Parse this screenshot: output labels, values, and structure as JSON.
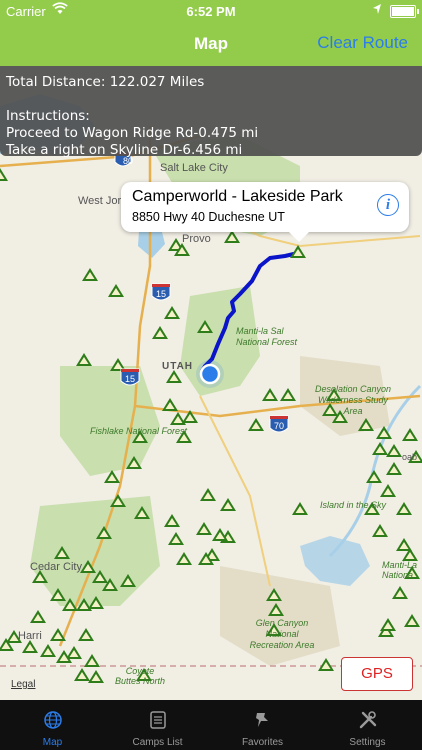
{
  "status_bar": {
    "carrier": "Carrier",
    "time": "6:52 PM"
  },
  "nav": {
    "title": "Map",
    "right_button": "Clear Route"
  },
  "route_info": {
    "total_distance": "Total Distance: 122.027 Miles",
    "instructions_heading": "Instructions:",
    "steps": [
      "Proceed to Wagon Ridge Rd-0.475 mi",
      "Take a right on Skyline Dr-6.456 mi"
    ]
  },
  "callout": {
    "title": "Camperworld - Lakeside Park",
    "subtitle": "8850 Hwy 40 Duchesne UT"
  },
  "map_labels": {
    "salt_lake_city": "Salt Lake City",
    "west_jordan": "West Jor",
    "provo": "Provo",
    "utah": "UTAH",
    "manti_la_sal": "Manti-la Sal National Forest",
    "desolation": "Desolation Canyon Wilderness Study Area",
    "fishlake": "Fishlake National Forest",
    "island_sky": "Island in the Sky",
    "cedar_city": "Cedar City",
    "harris": "Harri",
    "glen_canyon": "Glen Canyon National Recreation Area",
    "coyote_buttes": "Coyote Buttes North",
    "manti_la_sal_2": "Manti-La Nationa",
    "moab": "oab",
    "i80": "80",
    "i15a": "15",
    "i15b": "15",
    "i70": "70"
  },
  "map_controls": {
    "gps": "GPS",
    "legal": "Legal"
  },
  "tabs": [
    {
      "label": "Map",
      "icon": "globe-icon",
      "active": true
    },
    {
      "label": "Camps List",
      "icon": "list-icon",
      "active": false
    },
    {
      "label": "Favorites",
      "icon": "pin-icon",
      "active": false
    },
    {
      "label": "Settings",
      "icon": "tools-icon",
      "active": false
    }
  ],
  "colors": {
    "nav_bar": "#93cc4a",
    "accent": "#2b7de9",
    "route": "#0a14c8",
    "campsite": "#2e7d1a",
    "gps_border": "#cc3333"
  }
}
